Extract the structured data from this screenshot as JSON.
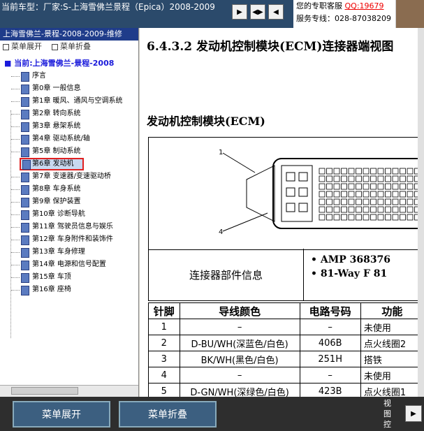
{
  "header": {
    "car_info": "当前车型：厂家:S-上海雪佛兰景程（Epica）2008-2009",
    "service_line1_prefix": "您的专职客服",
    "service_qq": "QQ:19679",
    "service_line2": "服务专线：028-87038209"
  },
  "sidebar": {
    "title": "上海雪佛兰-景程-2008-2009-维修",
    "expand_label": "菜单展开",
    "collapse_label": "菜单折叠",
    "root": "当前:上海雪佛兰-景程-2008",
    "items": [
      {
        "label": "序言"
      },
      {
        "label": "第0章  一般信息"
      },
      {
        "label": "第1章  暖风、通风与空调系统"
      },
      {
        "label": "第2章  转向系统"
      },
      {
        "label": "第3章  悬架系统"
      },
      {
        "label": "第4章  驱动系统/轴"
      },
      {
        "label": "第5章  制动系统"
      },
      {
        "label": "第6章  发动机"
      },
      {
        "label": "第7章  变速器/变速驱动桥"
      },
      {
        "label": "第8章  车身系统"
      },
      {
        "label": "第9章  保护装置"
      },
      {
        "label": "第10章  诊断导航"
      },
      {
        "label": "第11章  驾驶员信息与娱乐"
      },
      {
        "label": "第12章  车身附件和装饰件"
      },
      {
        "label": "第13章  车身修理"
      },
      {
        "label": "第14章  电源和信号配置"
      },
      {
        "label": "第15章  车顶"
      },
      {
        "label": "第16章  座椅"
      }
    ],
    "selected_index": 7
  },
  "document": {
    "heading": "6.4.3.2  发动机控制模块(ECM)连接器端视图",
    "subheading": "发动机控制模块(ECM)",
    "callout_1": "1",
    "callout_4": "4",
    "info_label": "连接器部件信息",
    "info_items": [
      "AMP 368376",
      "81-Way F 81"
    ],
    "table": {
      "headers": [
        "针脚",
        "导线颜色",
        "电路号码",
        "功能"
      ],
      "rows": [
        [
          "1",
          "–",
          "–",
          "未使用"
        ],
        [
          "2",
          "D-BU/WH(深蓝色/白色)",
          "406B",
          "点火线圈2"
        ],
        [
          "3",
          "BK/WH(黑色/白色)",
          "251H",
          "搭铁"
        ],
        [
          "4",
          "–",
          "–",
          "未使用"
        ],
        [
          "5",
          "D-GN/WH(深绿色/白色)",
          "423B",
          "点火线圈1"
        ]
      ]
    }
  },
  "footer": {
    "expand_button": "菜单展开",
    "collapse_button": "菜单折叠",
    "view_text": "视图控"
  },
  "colors": {
    "accent": "#1f3c8a",
    "selection_border": "#e02020",
    "qq": "#ee0000"
  }
}
